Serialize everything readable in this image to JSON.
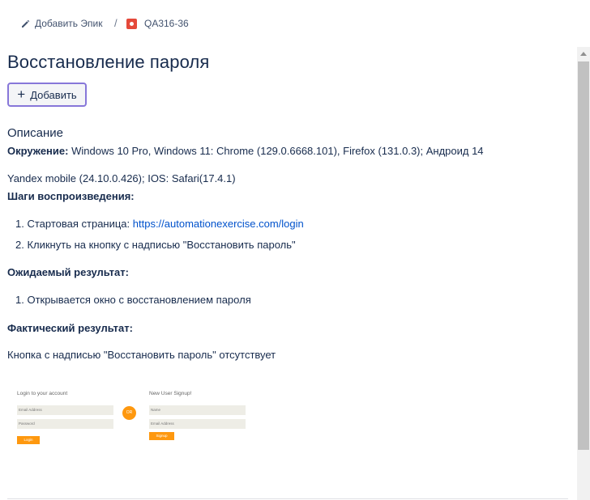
{
  "breadcrumb": {
    "add_epic_label": "Добавить Эпик",
    "separator": "/",
    "issue_key": "QA316-36"
  },
  "issue": {
    "title": "Восстановление пароля",
    "add_button_label": "Добавить"
  },
  "description": {
    "heading": "Описание",
    "environment_label": "Окружение:",
    "environment_value": "Windows 10 Pro, Windows 11: Chrome (129.0.6668.101), Firefox (131.0.3); Андроид 14",
    "environment_line2": "Yandex mobile (24.10.0.426); IOS: Safari(17.4.1)",
    "steps_label": "Шаги воспроизведения:",
    "steps": [
      {
        "text": "1. Стартовая страница: ",
        "link": "https://automationexercise.com/login"
      },
      {
        "text": "2. Кликнуть на кнопку с надписью \"Восстановить пароль\""
      }
    ],
    "expected_label": "Ожидаемый результат:",
    "expected_items": [
      "1. Открывается окно с восстановлением пароля"
    ],
    "actual_label": "Фактический результат:",
    "actual_text": "Кнопка с надписью \"Восстановить пароль\" отсутствует"
  },
  "attachment": {
    "login_heading": "Login to your account",
    "email_placeholder": "Email Address",
    "password_placeholder": "Password",
    "login_button": "Login",
    "or_label": "OR",
    "signup_heading": "New User Signup!",
    "name_placeholder": "Name",
    "signup_email_placeholder": "Email Address",
    "signup_button": "Signup"
  },
  "colors": {
    "accent_border": "#8777d9",
    "bug_icon": "#e5493a",
    "link": "#0052cc",
    "orange": "#fe980f"
  },
  "icons": {
    "add_epic": "pencil-icon",
    "issue_type": "bug-icon",
    "add": "plus-icon"
  }
}
